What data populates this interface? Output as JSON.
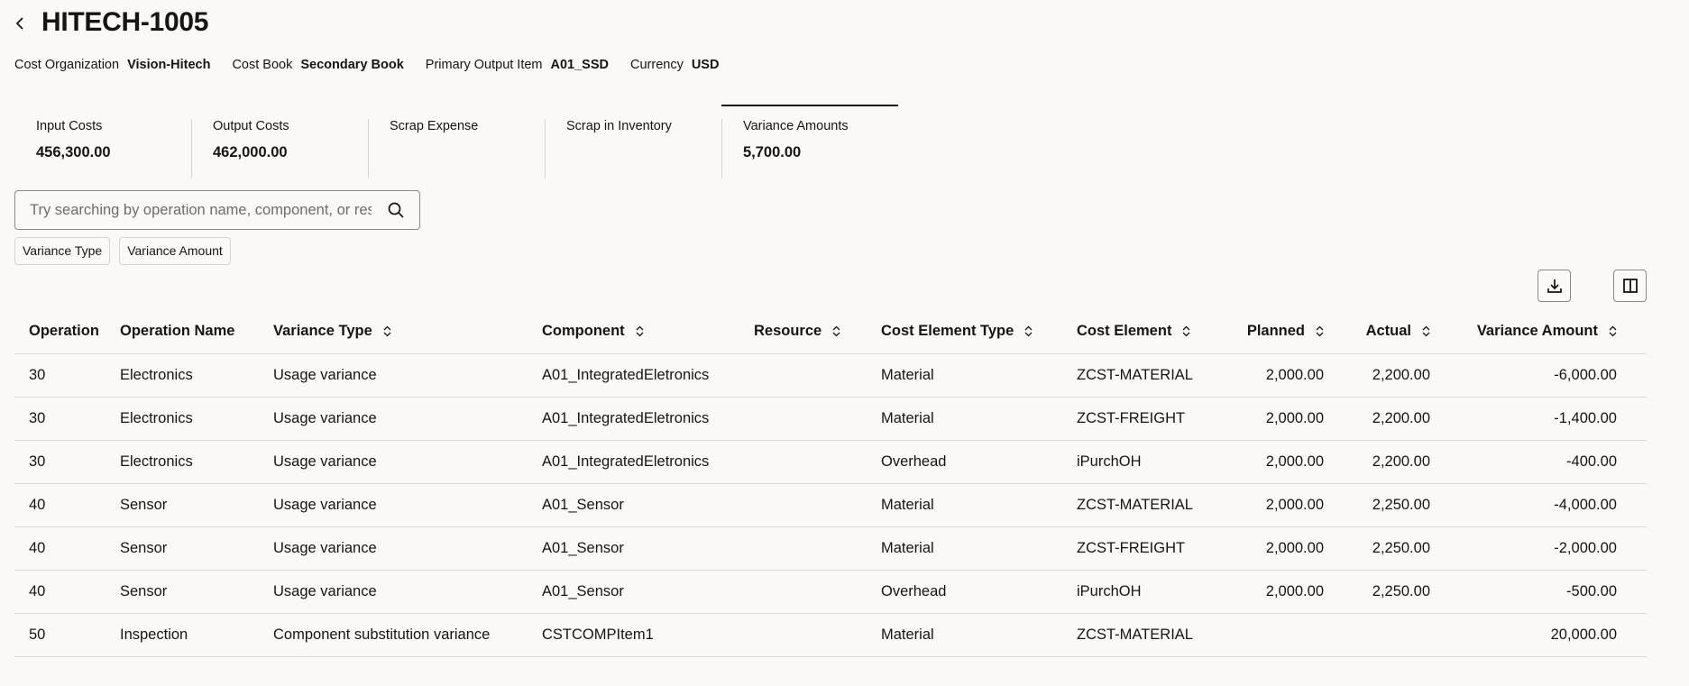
{
  "header": {
    "title": "HITECH-1005",
    "back_icon": "chevron-left-icon"
  },
  "meta": [
    {
      "label": "Cost Organization",
      "value": "Vision-Hitech"
    },
    {
      "label": "Cost Book",
      "value": "Secondary Book"
    },
    {
      "label": "Primary Output Item",
      "value": "A01_SSD"
    },
    {
      "label": "Currency",
      "value": "USD"
    }
  ],
  "tabs": [
    {
      "label": "Input Costs",
      "value": "456,300.00"
    },
    {
      "label": "Output Costs",
      "value": "462,000.00"
    },
    {
      "label": "Scrap Expense",
      "value": ""
    },
    {
      "label": "Scrap in Inventory",
      "value": ""
    },
    {
      "label": "Variance Amounts",
      "value": "5,700.00",
      "selected": true
    }
  ],
  "search": {
    "placeholder": "Try searching by operation name, component, or resource"
  },
  "chips": [
    "Variance Type",
    "Variance Amount"
  ],
  "table": {
    "columns": [
      "Operation",
      "Operation Name",
      "Variance Type",
      "Component",
      "Resource",
      "Cost Element Type",
      "Cost Element",
      "Planned",
      "Actual",
      "Variance Amount"
    ],
    "rows": [
      [
        "30",
        "Electronics",
        "Usage variance",
        "A01_IntegratedEletronics",
        "",
        "Material",
        "ZCST-MATERIAL",
        "2,000.00",
        "2,200.00",
        "-6,000.00"
      ],
      [
        "30",
        "Electronics",
        "Usage variance",
        "A01_IntegratedEletronics",
        "",
        "Material",
        "ZCST-FREIGHT",
        "2,000.00",
        "2,200.00",
        "-1,400.00"
      ],
      [
        "30",
        "Electronics",
        "Usage variance",
        "A01_IntegratedEletronics",
        "",
        "Overhead",
        "iPurchOH",
        "2,000.00",
        "2,200.00",
        "-400.00"
      ],
      [
        "40",
        "Sensor",
        "Usage variance",
        "A01_Sensor",
        "",
        "Material",
        "ZCST-MATERIAL",
        "2,000.00",
        "2,250.00",
        "-4,000.00"
      ],
      [
        "40",
        "Sensor",
        "Usage variance",
        "A01_Sensor",
        "",
        "Material",
        "ZCST-FREIGHT",
        "2,000.00",
        "2,250.00",
        "-2,000.00"
      ],
      [
        "40",
        "Sensor",
        "Usage variance",
        "A01_Sensor",
        "",
        "Overhead",
        "iPurchOH",
        "2,000.00",
        "2,250.00",
        "-500.00"
      ],
      [
        "50",
        "Inspection",
        "Component substitution variance",
        "CSTCOMPItem1",
        "",
        "Material",
        "ZCST-MATERIAL",
        "",
        "",
        "20,000.00"
      ]
    ]
  }
}
